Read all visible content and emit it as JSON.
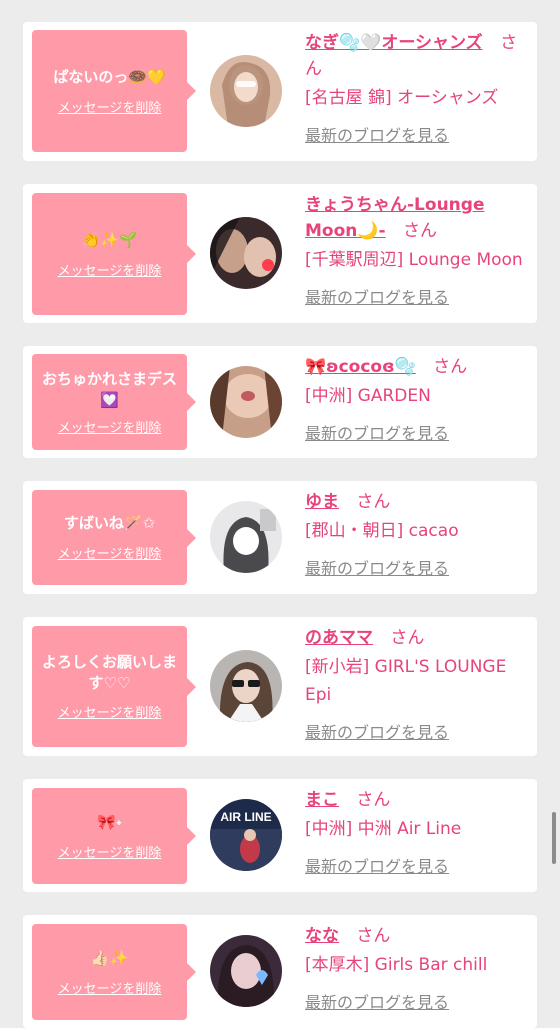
{
  "cards": [
    {
      "bubble_text": "ぱないのっ🍩💛",
      "delete_label": "メッセージを削除",
      "name": "なぎ🫧🤍オーシャンズ",
      "san": "さん",
      "shop": "[名古屋 錦] オーシャンズ",
      "blog_label": "最新のブログを見る"
    },
    {
      "bubble_text": "👏✨🌱",
      "delete_label": "メッセージを削除",
      "name": "きょうちゃん-Lounge Moon🌙-",
      "san": "さん",
      "shop": "[千葉駅周辺] Lounge Moon",
      "blog_label": "最新のブログを見る"
    },
    {
      "bubble_text": "おちゅかれさまデス💟",
      "delete_label": "メッセージを削除",
      "name": "🎀ʚcocoɞ🫧",
      "san": "さん",
      "shop": "[中洲] GARDEN",
      "blog_label": "最新のブログを見る"
    },
    {
      "bubble_text": "すばいね🪄✩",
      "delete_label": "メッセージを削除",
      "name": "ゆま",
      "san": "さん",
      "shop": "[郡山・朝日] cacao",
      "blog_label": "最新のブログを見る"
    },
    {
      "bubble_text": "よろしくお願いします♡♡",
      "delete_label": "メッセージを削除",
      "name": "のあママ",
      "san": "さん",
      "shop": "[新小岩] GIRL'S LOUNGE Epi",
      "blog_label": "最新のブログを見る"
    },
    {
      "bubble_text": "🎀˖",
      "delete_label": "メッセージを削除",
      "name": "まこ",
      "san": "さん",
      "shop": "[中洲] 中洲 Air Line",
      "blog_label": "最新のブログを見る"
    },
    {
      "bubble_text": "👍🏻✨",
      "delete_label": "メッセージを削除",
      "name": "なな",
      "san": "さん",
      "shop": "[本厚木] Girls Bar chill",
      "blog_label": "最新のブログを見る"
    }
  ],
  "avatar_caption": "AIR LINE",
  "colors": {
    "accent": "#e6447a",
    "bubble": "#ff9aa8",
    "background": "#ececec",
    "link_gray": "#8a8a8a"
  }
}
